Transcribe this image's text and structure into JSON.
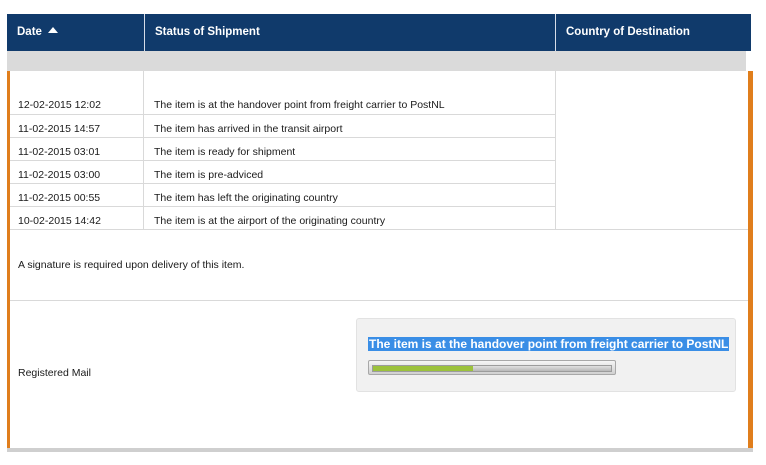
{
  "header": {
    "date_label": "Date",
    "status_label": "Status of Shipment",
    "country_label": "Country of Destination"
  },
  "rows": [
    {
      "date": "12-02-2015 12:02",
      "status": "The item is at the handover point from freight carrier to PostNL"
    },
    {
      "date": "11-02-2015 14:57",
      "status": "The item has arrived in the transit airport"
    },
    {
      "date": "11-02-2015 03:01",
      "status": "The item is ready for shipment"
    },
    {
      "date": "11-02-2015 03:00",
      "status": "The item is pre-adviced"
    },
    {
      "date": "11-02-2015 00:55",
      "status": "The item has left the originating country"
    },
    {
      "date": "10-02-2015 14:42",
      "status": "The item is at the airport of the originating country"
    }
  ],
  "signature_note": "A signature is required upon delivery of this item.",
  "mail_type": "Registered Mail",
  "current_status": {
    "text": "The item is at the handover point from freight carrier to PostNL",
    "progress": 0.42
  },
  "colors": {
    "header_bg": "#103a6b",
    "accent_orange": "#e07e1c",
    "progress_fill": "#9cc23c",
    "selection_highlight": "#3a8ee6"
  }
}
